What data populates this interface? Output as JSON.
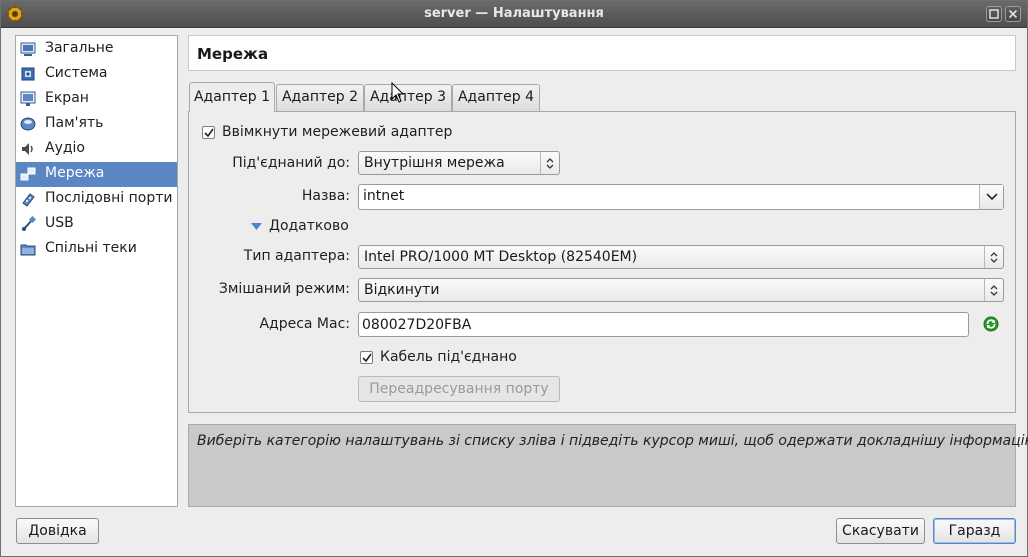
{
  "window": {
    "title": "server — Налаштування"
  },
  "sidebar": {
    "items": [
      {
        "label": "Загальне",
        "icon": "general-icon"
      },
      {
        "label": "Система",
        "icon": "system-icon"
      },
      {
        "label": "Екран",
        "icon": "display-icon"
      },
      {
        "label": "Пам'ять",
        "icon": "storage-icon"
      },
      {
        "label": "Аудіо",
        "icon": "audio-icon"
      },
      {
        "label": "Мережа",
        "icon": "network-icon",
        "selected": true
      },
      {
        "label": "Послідовні порти",
        "icon": "serial-ports-icon"
      },
      {
        "label": "USB",
        "icon": "usb-icon"
      },
      {
        "label": "Спільні теки",
        "icon": "shared-folders-icon"
      }
    ]
  },
  "header": {
    "title": "Мережа"
  },
  "tabs": [
    {
      "label": "Адаптер 1",
      "active": true
    },
    {
      "label": "Адаптер 2"
    },
    {
      "label": "Адаптер 3"
    },
    {
      "label": "Адаптер 4"
    }
  ],
  "adapter": {
    "enable_label": "Ввімкнути мережевий адаптер",
    "enabled": true,
    "attached_label": "Під'єднаний до:",
    "attached_value": "Внутрішня мережа",
    "name_label": "Назва:",
    "name_value": "intnet",
    "advanced_label": "Додатково",
    "type_label": "Тип адаптера:",
    "type_value": "Intel PRO/1000 MT Desktop (82540EM)",
    "promisc_label": "Змішаний режим:",
    "promisc_value": "Відкинути",
    "mac_label": "Адреса Mac:",
    "mac_value": "080027D20FBA",
    "cable_label": "Кабель під'єднано",
    "cable_connected": true,
    "port_forwarding_label": "Переадресування порту"
  },
  "info": {
    "text": "Виберіть категорію налаштувань зі списку зліва і підведіть курсор миші, щоб одержати докладнішу інформацію."
  },
  "buttons": {
    "help": "Довідка",
    "cancel": "Скасувати",
    "ok": "Гаразд"
  },
  "colors": {
    "selection": "#5a86c3",
    "titlebar": "#4e4e4e",
    "refresh_icon": "#2e9a2e"
  }
}
